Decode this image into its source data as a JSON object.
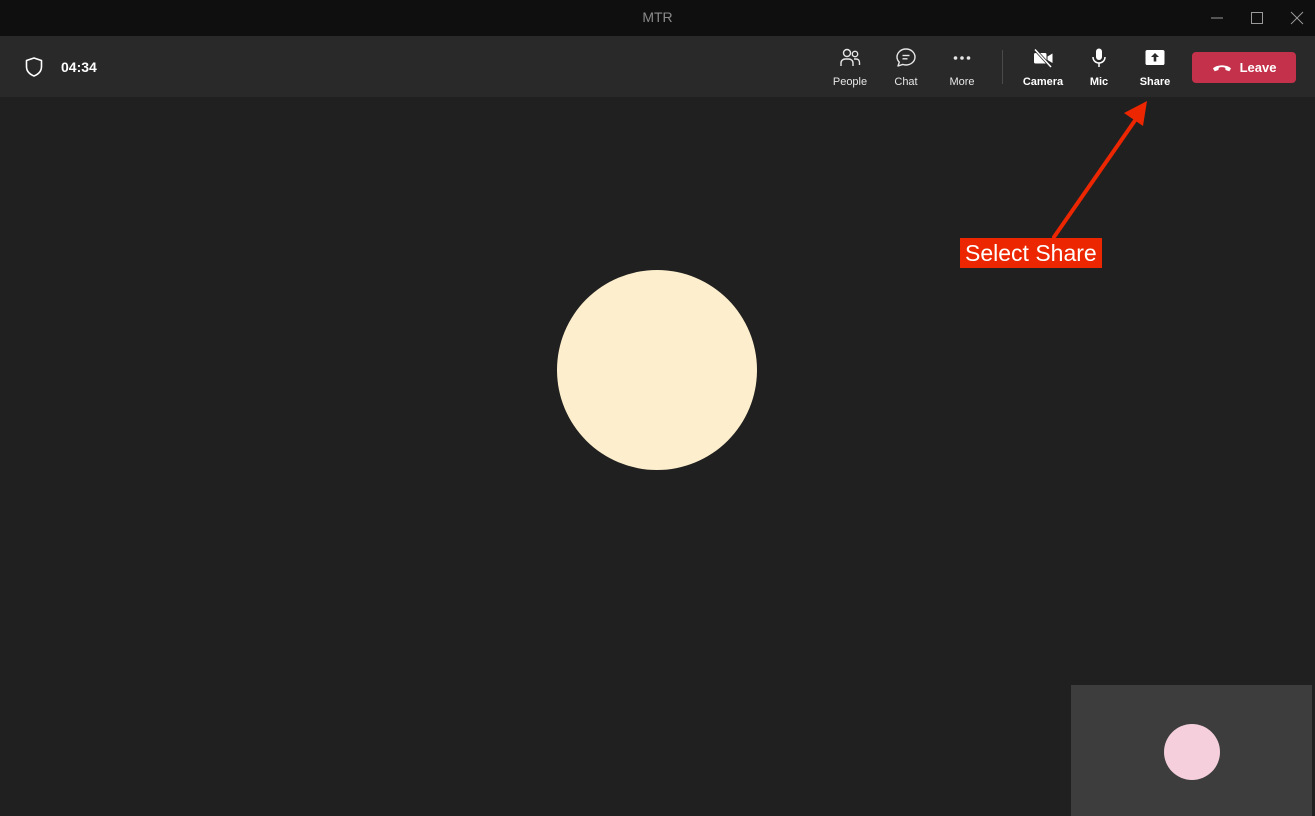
{
  "window": {
    "title": "MTR"
  },
  "meeting": {
    "elapsed_time": "04:34"
  },
  "toolbar": {
    "people_label": "People",
    "chat_label": "Chat",
    "more_label": "More",
    "camera_label": "Camera",
    "mic_label": "Mic",
    "share_label": "Share",
    "leave_label": "Leave"
  },
  "annotation": {
    "text": "Select Share"
  },
  "colors": {
    "title_bar": "#0f0f0f",
    "toolbar": "#292929",
    "stage": "#202020",
    "leave_button": "#c4314b",
    "annotation": "#ec2600",
    "main_avatar": "#fdefcd",
    "self_avatar": "#f5d0dc",
    "self_view_tile": "#3d3d3d"
  },
  "icons": {
    "security": "shield-icon",
    "people": "people-icon",
    "chat": "chat-icon",
    "more": "more-icon",
    "camera": "camera-off-icon",
    "mic": "mic-icon",
    "share": "share-icon",
    "leave": "phone-hangup-icon"
  }
}
